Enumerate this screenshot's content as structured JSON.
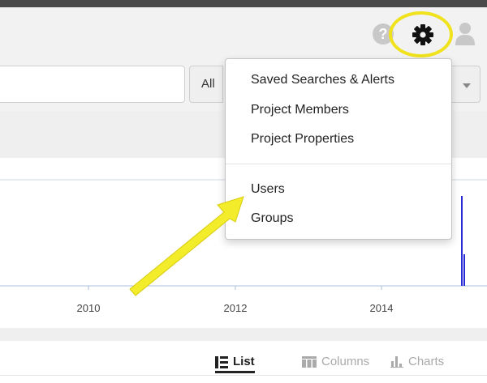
{
  "header": {
    "help_icon_glyph": "?",
    "icons": [
      "help-icon",
      "gear-icon",
      "user-icon"
    ],
    "highlight_color": "#f0e21c"
  },
  "filter": {
    "scope_label": "All"
  },
  "menu": {
    "items": [
      {
        "label": "Saved Searches & Alerts"
      },
      {
        "label": "Project Members"
      },
      {
        "label": "Project Properties"
      },
      {
        "label": "Users"
      },
      {
        "label": "Groups"
      }
    ]
  },
  "timeline": {
    "tick_labels": [
      "2010",
      "2012",
      "2014"
    ],
    "bar_color": "#2b2bd6"
  },
  "view_tabs": [
    {
      "label": "List",
      "active": true,
      "icon": "list-icon"
    },
    {
      "label": "Columns",
      "active": false,
      "icon": "columns-icon"
    },
    {
      "label": "Charts",
      "active": false,
      "icon": "charts-icon"
    }
  ]
}
